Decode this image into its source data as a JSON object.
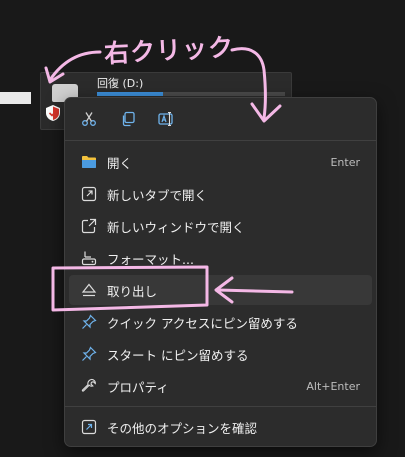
{
  "annotation": {
    "text": "右クリック",
    "color": "#f4b8e6"
  },
  "drive": {
    "label": "回復 (D:)",
    "usage_fraction": 0.35,
    "icon": "drive-icon"
  },
  "quick_actions": [
    {
      "name": "cut",
      "icon": "scissors-icon"
    },
    {
      "name": "copy",
      "icon": "copy-icon"
    },
    {
      "name": "rename",
      "icon": "rename-icon"
    }
  ],
  "menu": {
    "items": [
      {
        "label": "開く",
        "shortcut": "Enter",
        "icon": "folder-icon"
      },
      {
        "label": "新しいタブで開く",
        "shortcut": "",
        "icon": "open-new-tab-icon"
      },
      {
        "label": "新しいウィンドウで開く",
        "shortcut": "",
        "icon": "open-new-window-icon"
      },
      {
        "label": "フォーマット...",
        "shortcut": "",
        "icon": "format-icon"
      },
      {
        "label": "取り出し",
        "shortcut": "",
        "icon": "eject-icon"
      },
      {
        "label": "クイック アクセスにピン留めする",
        "shortcut": "",
        "icon": "pin-icon"
      },
      {
        "label": "スタート にピン留めする",
        "shortcut": "",
        "icon": "pin-icon"
      },
      {
        "label": "プロパティ",
        "shortcut": "Alt+Enter",
        "icon": "wrench-icon"
      },
      {
        "label": "その他のオプションを確認",
        "shortcut": "",
        "icon": "more-options-icon"
      }
    ]
  },
  "colors": {
    "accent": "#3b8ed8",
    "menu_bg": "#2c2c2c",
    "highlight_bg": "#383838"
  }
}
